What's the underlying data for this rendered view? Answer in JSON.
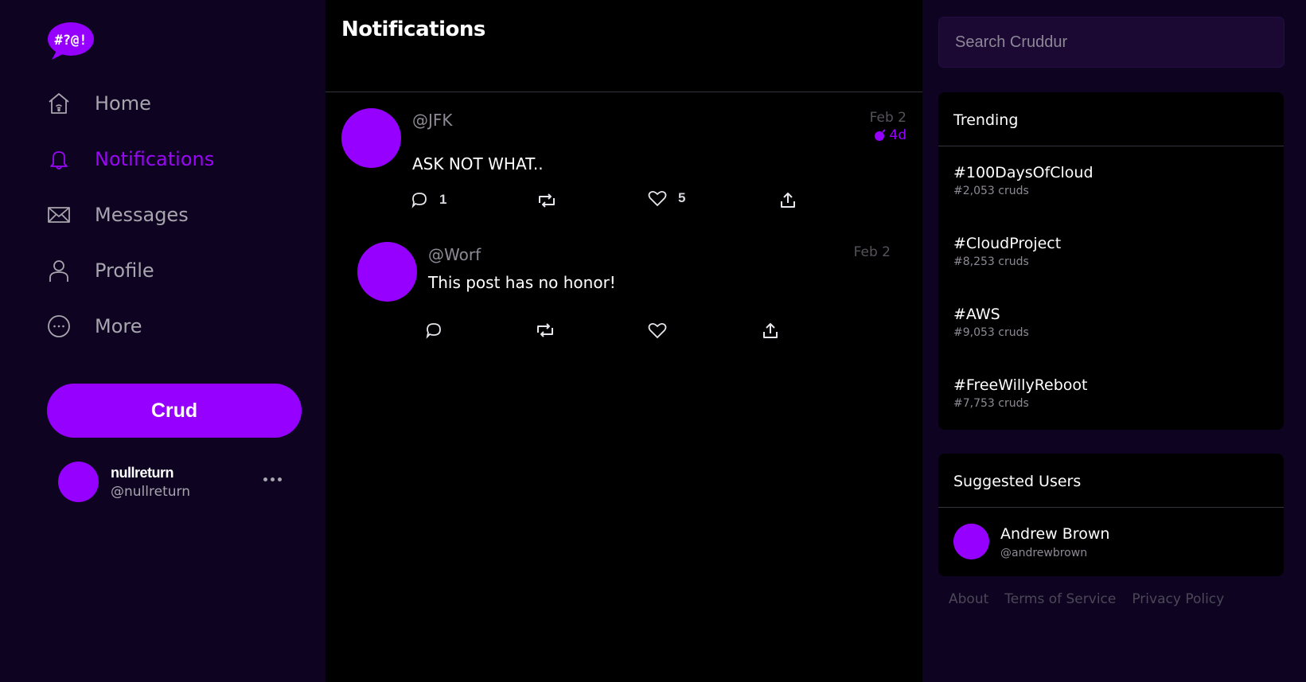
{
  "app": {
    "brand_logo_text": "#?@!"
  },
  "sidebar": {
    "nav": [
      {
        "label": "Home",
        "icon": "home-icon",
        "active": false
      },
      {
        "label": "Notifications",
        "icon": "bell-icon",
        "active": true
      },
      {
        "label": "Messages",
        "icon": "envelope-icon",
        "active": false
      },
      {
        "label": "Profile",
        "icon": "person-icon",
        "active": false
      },
      {
        "label": "More",
        "icon": "more-circle-icon",
        "active": false
      }
    ],
    "crud_button_label": "Crud",
    "current_user": {
      "display_name": "nullreturn",
      "handle": "@nullreturn"
    }
  },
  "feed": {
    "title": "Notifications",
    "activities": [
      {
        "handle": "@JFK",
        "message": "ASK NOT WHAT..",
        "date": "Feb 2",
        "expires": "4d",
        "replies": "1",
        "likes": "5"
      },
      {
        "handle": "@Worf",
        "message": "This post has no honor!",
        "date": "Feb 2",
        "expires": "",
        "replies": "",
        "likes": ""
      }
    ]
  },
  "right": {
    "search_placeholder": "Search Cruddur",
    "trending": {
      "title": "Trending",
      "items": [
        {
          "tag": "#100DaysOfCloud",
          "count": "#2,053 cruds"
        },
        {
          "tag": "#CloudProject",
          "count": "#8,253 cruds"
        },
        {
          "tag": "#AWS",
          "count": "#9,053 cruds"
        },
        {
          "tag": "#FreeWillyReboot",
          "count": "#7,753 cruds"
        }
      ]
    },
    "suggested": {
      "title": "Suggested Users",
      "users": [
        {
          "name": "Andrew Brown",
          "handle": "@andrewbrown"
        }
      ]
    },
    "footer": {
      "about": "About",
      "terms": "Terms of Service",
      "privacy": "Privacy Policy"
    }
  },
  "colors": {
    "accent": "#9500ff",
    "sidebar_bg": "#0e0321",
    "feed_bg": "#000000",
    "muted_text": "#a7a5ae"
  }
}
